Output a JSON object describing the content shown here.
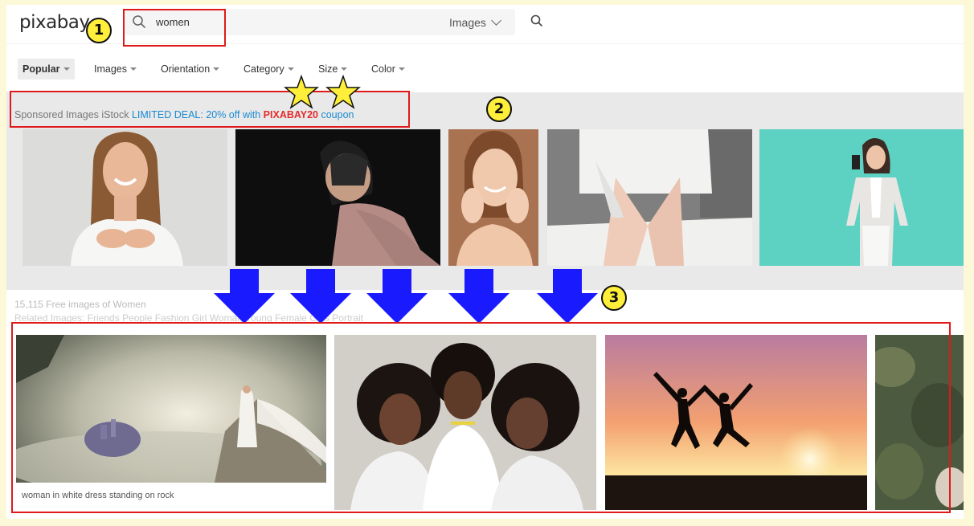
{
  "header": {
    "logo": "pixabay",
    "search_value": "women",
    "search_type": "Images"
  },
  "filters": [
    {
      "label": "Popular",
      "active": true
    },
    {
      "label": "Images"
    },
    {
      "label": "Orientation"
    },
    {
      "label": "Category"
    },
    {
      "label": "Size"
    },
    {
      "label": "Color"
    }
  ],
  "sponsored": {
    "prefix": "Sponsored Images iStock",
    "deal": "LIMITED DEAL: 20% off with",
    "code": "PIXABAY20",
    "suffix": "coupon"
  },
  "results": {
    "count_text": "15,115 Free images of Women",
    "related_text": "Related Images:    Friends  People  Fashion  Girl  Woman  Young  Female  Girls  Portrait"
  },
  "result_images": [
    {
      "caption": "woman in white dress standing on rock"
    }
  ],
  "annotations": {
    "badge_1": "1",
    "badge_2": "2",
    "badge_3": "3"
  },
  "colors": {
    "annotation_red": "#e01a1a",
    "arrow_blue": "#1a1aff",
    "badge_yellow": "#ffef3a",
    "star_yellow": "#ffef3a",
    "deal_blue": "#1b8ad2",
    "code_red": "#e52b2b",
    "outer_bg": "#fdf8d8"
  }
}
